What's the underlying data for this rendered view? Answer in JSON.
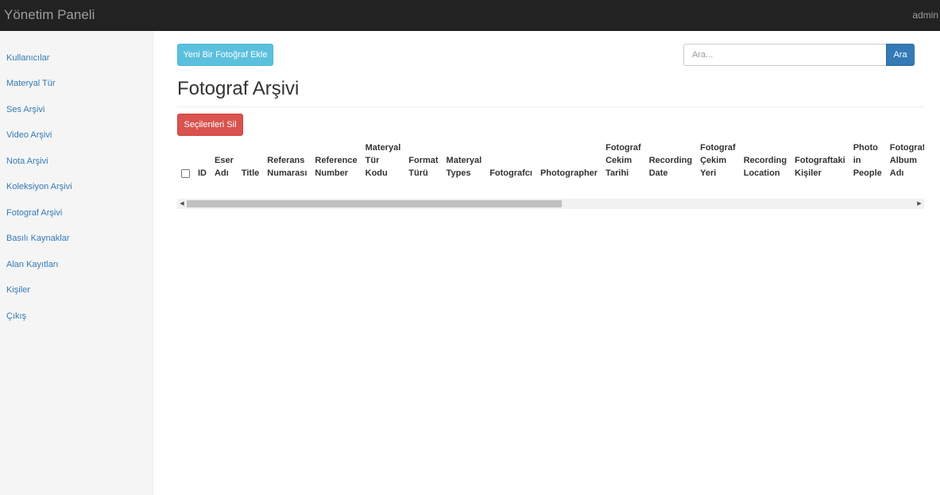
{
  "header": {
    "brand": "Yönetim Paneli",
    "user": "admin"
  },
  "sidebar": {
    "items": [
      {
        "label": "Kullanıcılar"
      },
      {
        "label": "Materyal Tür"
      },
      {
        "label": "Ses Arşivi"
      },
      {
        "label": "Video Arşivi"
      },
      {
        "label": "Nota Arşivi"
      },
      {
        "label": "Koleksiyon Arşivi"
      },
      {
        "label": "Fotograf Arşivi"
      },
      {
        "label": "Basılı Kaynaklar"
      },
      {
        "label": "Alan Kayıtları"
      },
      {
        "label": "Kişiler"
      },
      {
        "label": "Çıkış"
      }
    ]
  },
  "toolbar": {
    "add_label": "Yeni Bir Fotoğraf Ekle",
    "search_placeholder": "Ara...",
    "search_button": "Ara",
    "delete_selected_label": "Seçilenleri Sil"
  },
  "page": {
    "title": "Fotograf Arşivi"
  },
  "table": {
    "columns": [
      [
        "ID"
      ],
      [
        "Eser",
        "Adı"
      ],
      [
        "Title"
      ],
      [
        "Referans",
        "Numarası"
      ],
      [
        "Reference",
        "Number"
      ],
      [
        "Materyal",
        "Tür",
        "Kodu"
      ],
      [
        "Format",
        "Türü"
      ],
      [
        "Materyal",
        "Types"
      ],
      [
        "Fotografcı"
      ],
      [
        "Photographer"
      ],
      [
        "Fotograf",
        "Cekim",
        "Tarihi"
      ],
      [
        "Recording",
        "Date"
      ],
      [
        "Fotograf",
        "Çekim",
        "Yeri"
      ],
      [
        "Recording",
        "Location"
      ],
      [
        "Fotograftaki",
        "Kişiler"
      ],
      [
        "Photo",
        "in",
        "People"
      ],
      [
        "Fotograf",
        "Album",
        "Adı"
      ]
    ],
    "rows": []
  },
  "icons": {
    "scroll_left": "triangle-left-icon",
    "scroll_right": "triangle-right-icon"
  },
  "colors": {
    "navbar": "#222222",
    "link": "#337ab7",
    "info": "#5bc0de",
    "danger": "#d9534f",
    "primary": "#337ab7"
  }
}
